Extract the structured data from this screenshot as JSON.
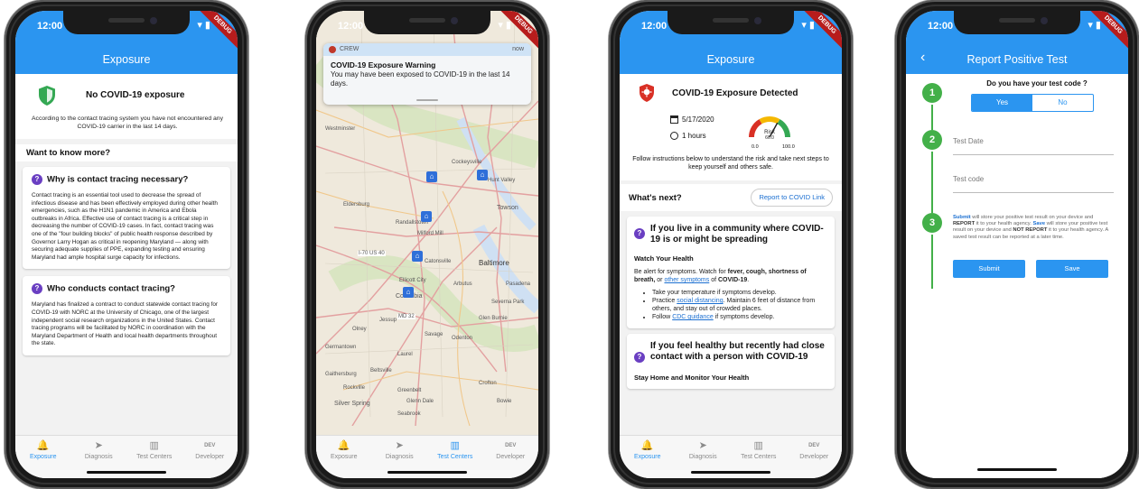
{
  "status": {
    "time": "12:00",
    "debug": "DEBUG",
    "wifi": "▾ ▮"
  },
  "tabs": [
    {
      "label": "Exposure",
      "icon": "bell-icon",
      "glyph": "🔔"
    },
    {
      "label": "Diagnosis",
      "icon": "send-icon",
      "glyph": "➤"
    },
    {
      "label": "Test Centers",
      "icon": "map-icon",
      "glyph": "▥"
    },
    {
      "label": "Developer",
      "icon": "dev-icon",
      "glyph": "DEV"
    }
  ],
  "screen1": {
    "title": "Exposure",
    "status_title": "No COVID-19 exposure",
    "status_text": "According to the contact tracing system you have not encountered any COVID-19 carrier in the last 14 days.",
    "section": "Want to know more?",
    "q1_title": "Why is contact tracing necessary?",
    "q1_body": "Contact tracing is an essential tool used to decrease the spread of infectious disease and has been effectively employed during other health emergencies, such as the H1N1 pandemic in America and Ebola outbreaks in Africa. Effective use of contact tracing is a critical step in decreasing the number of COVID-19 cases. In fact, contact tracing was one of the \"four building blocks\" of public health response described by Governor Larry Hogan as critical in reopening Maryland — along with securing adequate supplies of PPE, expanding testing and ensuring Maryland had ample hospital surge capacity for infections.",
    "q2_title": "Who conducts contact tracing?",
    "q2_body": "Maryland has finalized a contract to conduct statewide contact tracing for COVID-19 with NORC at the University of Chicago, one of the largest independent social research organizations in the United States. Contact tracing programs will be facilitated by NORC in coordination with the Maryland Department of Health and local health departments throughout the state."
  },
  "screen2": {
    "notif_app": "CREW",
    "notif_time": "now",
    "notif_title": "COVID-19 Exposure Warning",
    "notif_body": "You may have been exposed to COVID-19 in the last 14 days.",
    "places": [
      "Westminster",
      "Eldersburg",
      "Randallstown",
      "Milford Mill",
      "Towson",
      "Baltimore",
      "Ellicott City",
      "Columbia",
      "Arbutus",
      "Glen Burnie",
      "Laurel",
      "Crofton",
      "Silver Spring",
      "Severna Park",
      "Pasadena",
      "Odenton",
      "Catonsville",
      "Germantown",
      "Olney",
      "Gaithersburg",
      "Rockville",
      "Greenbelt",
      "Bowie",
      "Seabrook",
      "Beltsville",
      "Glenn Dale",
      "Savage",
      "Jessup",
      "Cockeysville",
      "Hunt Valley",
      "I-70 US 40",
      "MD 32"
    ]
  },
  "screen3": {
    "title": "Exposure",
    "detected_title": "COVID-19 Exposure Detected",
    "date": "5/17/2020",
    "duration": "1 hours",
    "risk_label": "Risk",
    "risk_value": "66.0",
    "risk_min": "0.0",
    "risk_max": "100.0",
    "risk_fraction": 0.66,
    "instructions": "Follow instructions below to understand the risk and take next steps to keep yourself and others safe.",
    "next_label": "What's next?",
    "report_link": "Report to COVID Link",
    "s1_title": "If you live in a community where COVID-19 is or might be spreading",
    "s1_sub": "Watch Your Health",
    "s1_p1a": "Be alert for symptoms. Watch for ",
    "s1_p1b": "fever, cough, shortness of breath,",
    "s1_p1c": " or ",
    "s1_p1link": "other symptoms",
    "s1_p1d": " of ",
    "s1_p1e": "COVID-19",
    "s1_p1f": ".",
    "b1": "Take your temperature if symptoms develop.",
    "b2a": "Practice ",
    "b2link": "social distancing",
    "b2b": ". Maintain 6 feet of distance from others, and stay out of crowded places.",
    "b3a": "Follow ",
    "b3link": "CDC guidance",
    "b3b": " if symptoms develop.",
    "s2_title": "If you feel healthy but recently had close contact with a person with COVID-19",
    "s2_sub": "Stay Home and Monitor Your Health"
  },
  "screen4": {
    "title": "Report Positive Test",
    "back": "‹",
    "step1": "1",
    "step2": "2",
    "step3": "3",
    "question": "Do you have your test code ?",
    "yes": "Yes",
    "no": "No",
    "test_date": "Test Date",
    "test_code": "Test code",
    "i_submit": "Submit",
    "i_t1": " will store your positive test result on your device and ",
    "i_report1": "REPORT",
    "i_t2": " it to your health agency. ",
    "i_save": "Save",
    "i_t3": " will store your positive test result on your device and ",
    "i_notreport": "NOT REPORT",
    "i_t4": " it to your health agency. A saved test result can be reported at a later time.",
    "submit": "Submit",
    "save": "Save"
  }
}
